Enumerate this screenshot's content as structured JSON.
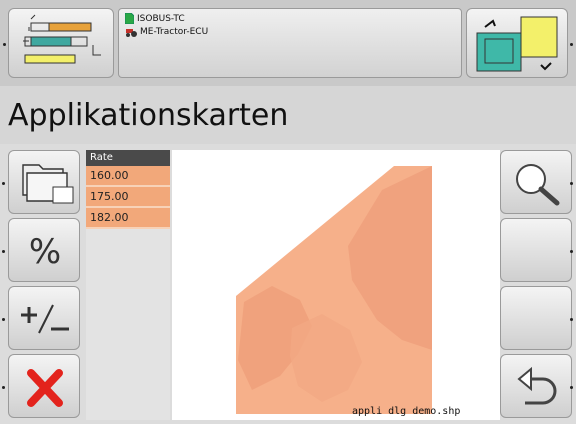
{
  "header": {
    "info_line1": "ISOBUS-TC",
    "info_line2": "ME-Tractor-ECU",
    "left_icon": "implement-section-icon",
    "right_icon": "switch-view-icon"
  },
  "page": {
    "title": "Applikationskarten"
  },
  "left_buttons": [
    {
      "icon": "folder-icon"
    },
    {
      "icon": "percent-icon",
      "label": "%"
    },
    {
      "icon": "plus-minus-icon",
      "label": "+/−"
    },
    {
      "icon": "cancel-x-icon"
    }
  ],
  "right_buttons": [
    {
      "icon": "zoom-icon"
    },
    {
      "icon": "empty-icon"
    },
    {
      "icon": "empty-icon"
    },
    {
      "icon": "return-icon"
    }
  ],
  "rate_table": {
    "header": "Rate",
    "rows": [
      "160.00",
      "175.00",
      "182.00"
    ]
  },
  "map": {
    "filename": "appli dlg demo.shp",
    "colors": {
      "base": "#f6b08a",
      "dark": "#ee9c78"
    }
  },
  "colors": {
    "accent_red": "#e3231c",
    "rate_row": "#f2a87a",
    "table_header": "#4a4a4a"
  }
}
